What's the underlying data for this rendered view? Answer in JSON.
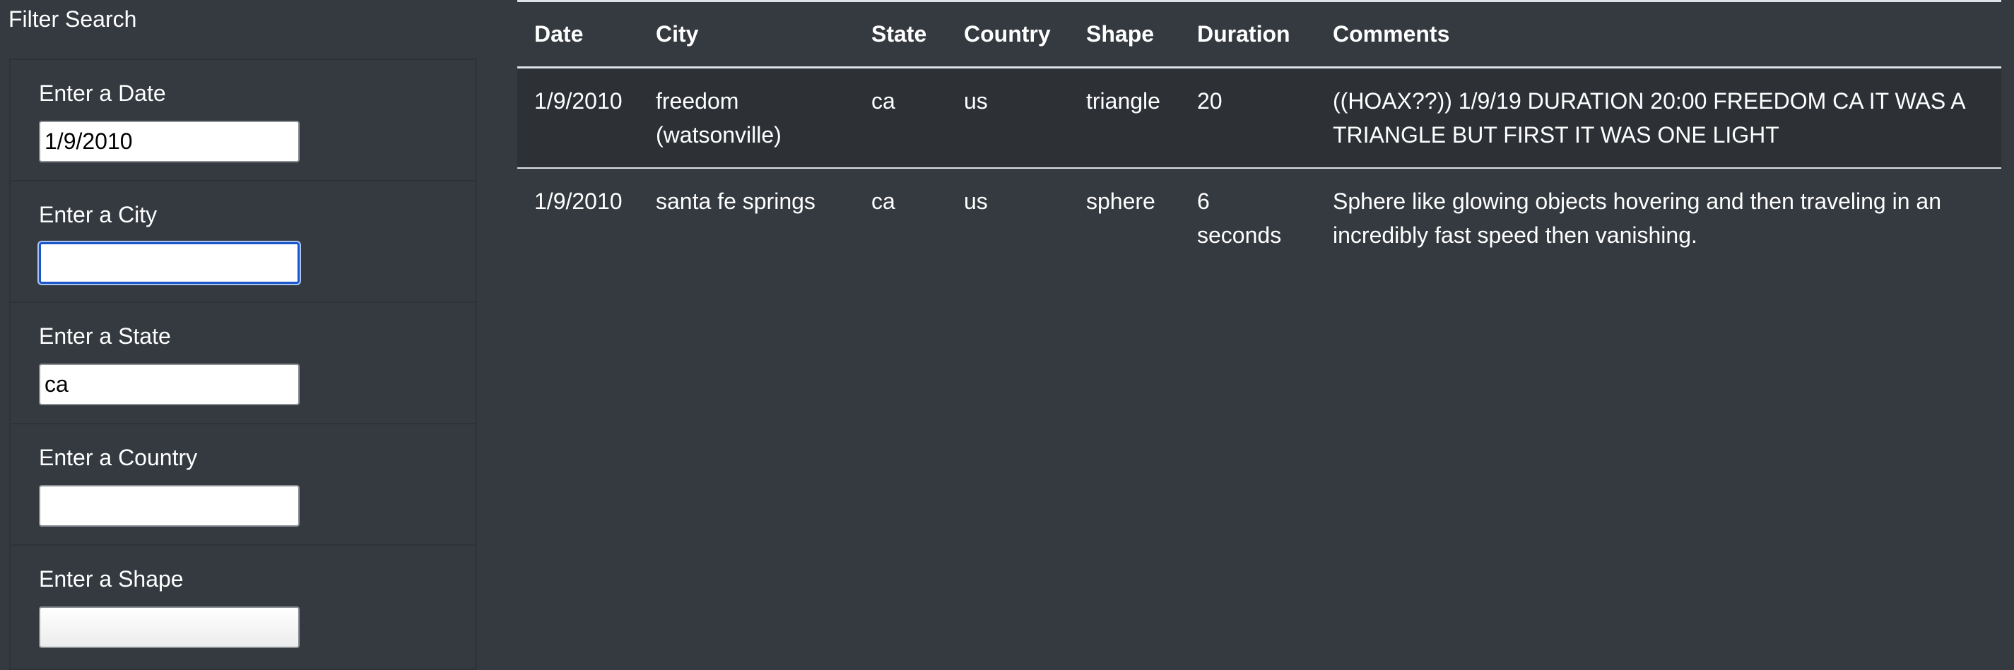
{
  "sidebar": {
    "title": "Filter Search",
    "filters": [
      {
        "label": "Enter a Date",
        "value": "1/9/2010"
      },
      {
        "label": "Enter a City",
        "value": ""
      },
      {
        "label": "Enter a State",
        "value": "ca"
      },
      {
        "label": "Enter a Country",
        "value": ""
      },
      {
        "label": "Enter a Shape",
        "value": ""
      }
    ]
  },
  "table": {
    "headers": [
      "Date",
      "City",
      "State",
      "Country",
      "Shape",
      "Duration",
      "Comments"
    ],
    "rows": [
      {
        "date": "1/9/2010",
        "city": "freedom (watsonville)",
        "state": "ca",
        "country": "us",
        "shape": "triangle",
        "duration": "20",
        "comments": "((HOAX??)) 1/9/19 DURATION 20:00 FREEDOM CA IT WAS A TRIANGLE BUT FIRST IT WAS ONE LIGHT"
      },
      {
        "date": "1/9/2010",
        "city": "santa fe springs",
        "state": "ca",
        "country": "us",
        "shape": "sphere",
        "duration": "6 seconds",
        "comments": "Sphere like glowing objects hovering and then traveling in an incredibly fast speed then vanishing."
      }
    ]
  },
  "colors": {
    "background": "#343a40",
    "stripe": "#2d3136",
    "rule": "#dee2e6",
    "focus": "#1a56c9",
    "text": "#ffffff"
  }
}
